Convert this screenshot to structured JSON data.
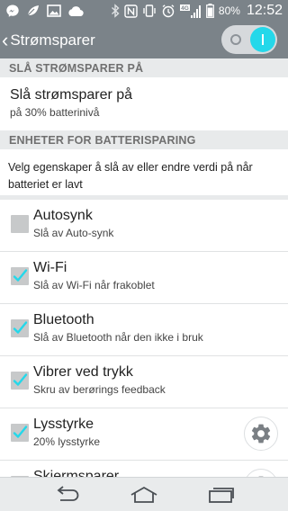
{
  "status_bar": {
    "left_icons": [
      "messenger-icon",
      "leaf-icon",
      "image-icon",
      "cloud-icon"
    ],
    "right_icons": [
      "bluetooth-icon",
      "nfc-icon",
      "vibrate-icon",
      "alarm-icon",
      "4g-signal-icon",
      "battery-icon"
    ],
    "network_label": "4G",
    "battery_text": "80%",
    "time": "12:52"
  },
  "action_bar": {
    "title": "Strømsparer",
    "toggle_on": true
  },
  "sections": {
    "header_1": "SLÅ STRØMSPARER PÅ",
    "header_2": "ENHETER FOR BATTERISPARING"
  },
  "main_setting": {
    "title": "Slå strømsparer på",
    "subtitle": "på 30% batterinivå"
  },
  "description": "Velg egenskaper å slå av eller endre verdi på når batteriet er lavt",
  "items": [
    {
      "title": "Autosynk",
      "subtitle": "Slå av Auto-synk",
      "checked": false,
      "has_settings": false
    },
    {
      "title": "Wi-Fi",
      "subtitle": "Slå av Wi-Fi når frakoblet",
      "checked": true,
      "has_settings": false
    },
    {
      "title": "Bluetooth",
      "subtitle": "Slå av Bluetooth når den ikke i bruk",
      "checked": true,
      "has_settings": false
    },
    {
      "title": "Vibrer ved trykk",
      "subtitle": "Skru av berørings feedback",
      "checked": true,
      "has_settings": false
    },
    {
      "title": "Lysstyrke",
      "subtitle": "20% lysstyrke",
      "checked": true,
      "has_settings": true
    },
    {
      "title": "Skjermsparer",
      "subtitle": "",
      "checked": true,
      "has_settings": true
    }
  ],
  "nav_bar": {
    "buttons": [
      "back-icon",
      "home-icon",
      "recent-apps-icon"
    ]
  },
  "colors": {
    "bar": "#7b8389",
    "accent": "#24d8ea",
    "section_bg": "#e8eaeb"
  }
}
